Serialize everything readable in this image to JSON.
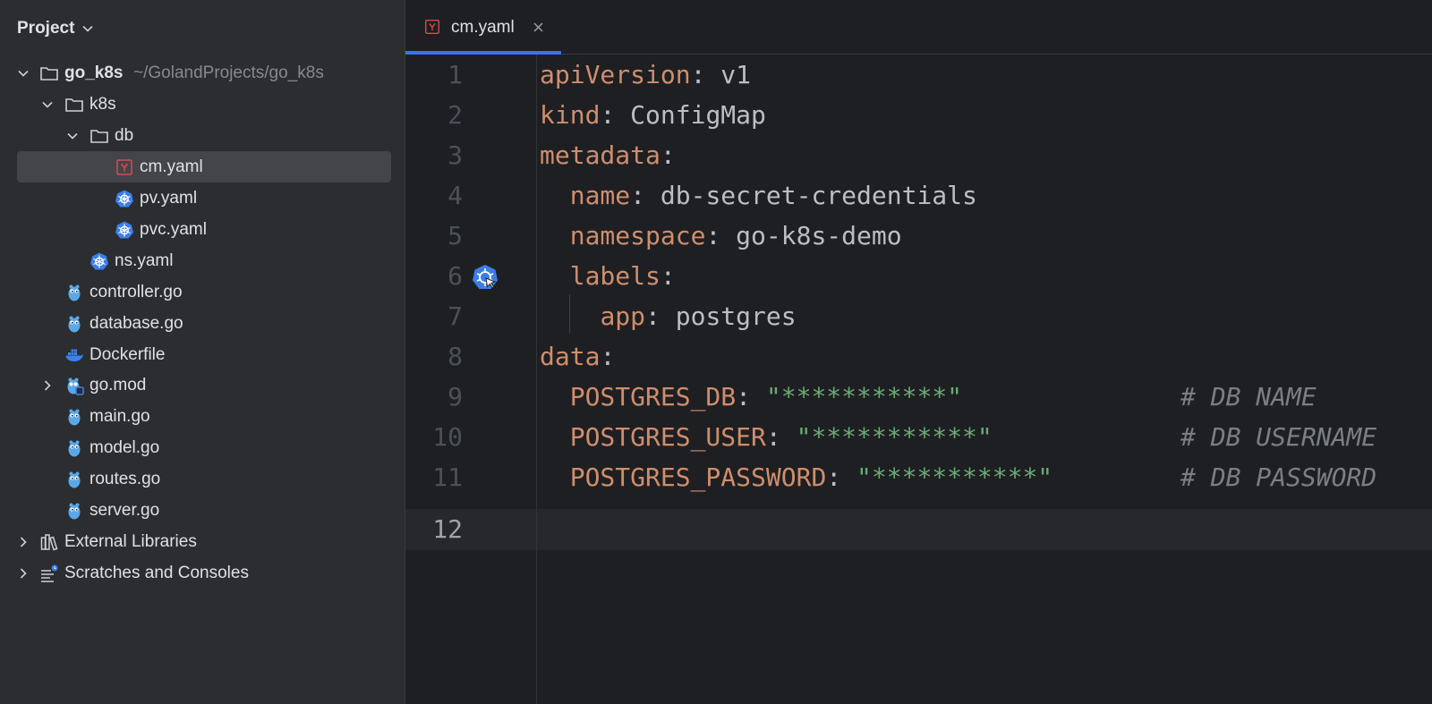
{
  "sidebar": {
    "title": "Project",
    "root": {
      "name": "go_k8s",
      "path": "~/GolandProjects/go_k8s"
    },
    "items": [
      {
        "label": "k8s"
      },
      {
        "label": "db"
      },
      {
        "label": "cm.yaml"
      },
      {
        "label": "pv.yaml"
      },
      {
        "label": "pvc.yaml"
      },
      {
        "label": "ns.yaml"
      },
      {
        "label": "controller.go"
      },
      {
        "label": "database.go"
      },
      {
        "label": "Dockerfile"
      },
      {
        "label": "go.mod"
      },
      {
        "label": "main.go"
      },
      {
        "label": "model.go"
      },
      {
        "label": "routes.go"
      },
      {
        "label": "server.go"
      },
      {
        "label": "External Libraries"
      },
      {
        "label": "Scratches and Consoles"
      }
    ],
    "selected": "cm.yaml"
  },
  "tabs": [
    {
      "label": "cm.yaml",
      "icon": "yaml-icon",
      "active": true
    }
  ],
  "editor": {
    "current_line": 12,
    "lines": [
      {
        "n": "1",
        "key": "apiVersion",
        "sep": ": ",
        "value": "v1"
      },
      {
        "n": "2",
        "key": "kind",
        "sep": ": ",
        "value": "ConfigMap"
      },
      {
        "n": "3",
        "key": "metadata",
        "sep": ":",
        "value": ""
      },
      {
        "n": "4",
        "key": "name",
        "sep": ": ",
        "value": "db-secret-credentials"
      },
      {
        "n": "5",
        "key": "namespace",
        "sep": ": ",
        "value": "go-k8s-demo"
      },
      {
        "n": "6",
        "key": "labels",
        "sep": ":",
        "value": ""
      },
      {
        "n": "7",
        "key": "app",
        "sep": ": ",
        "value": "postgres"
      },
      {
        "n": "8",
        "key": "data",
        "sep": ":",
        "value": ""
      },
      {
        "n": "9",
        "key": "POSTGRES_DB",
        "sep": ": ",
        "value": "\"***********\"",
        "comment": "# DB NAME"
      },
      {
        "n": "10",
        "key": "POSTGRES_USER",
        "sep": ": ",
        "value": "\"***********\"",
        "comment": "# DB USERNAME"
      },
      {
        "n": "11",
        "key": "POSTGRES_PASSWORD",
        "sep": ": ",
        "value": "\"***********\"",
        "comment": "# DB PASSWORD"
      },
      {
        "n": "12"
      }
    ]
  },
  "colors": {
    "accent": "#3574f0",
    "key": "#cf8e6d",
    "string": "#6aab73",
    "comment": "#7a7e85",
    "kubernetes": "#3b7ee8",
    "yaml": "#d94b4b"
  }
}
